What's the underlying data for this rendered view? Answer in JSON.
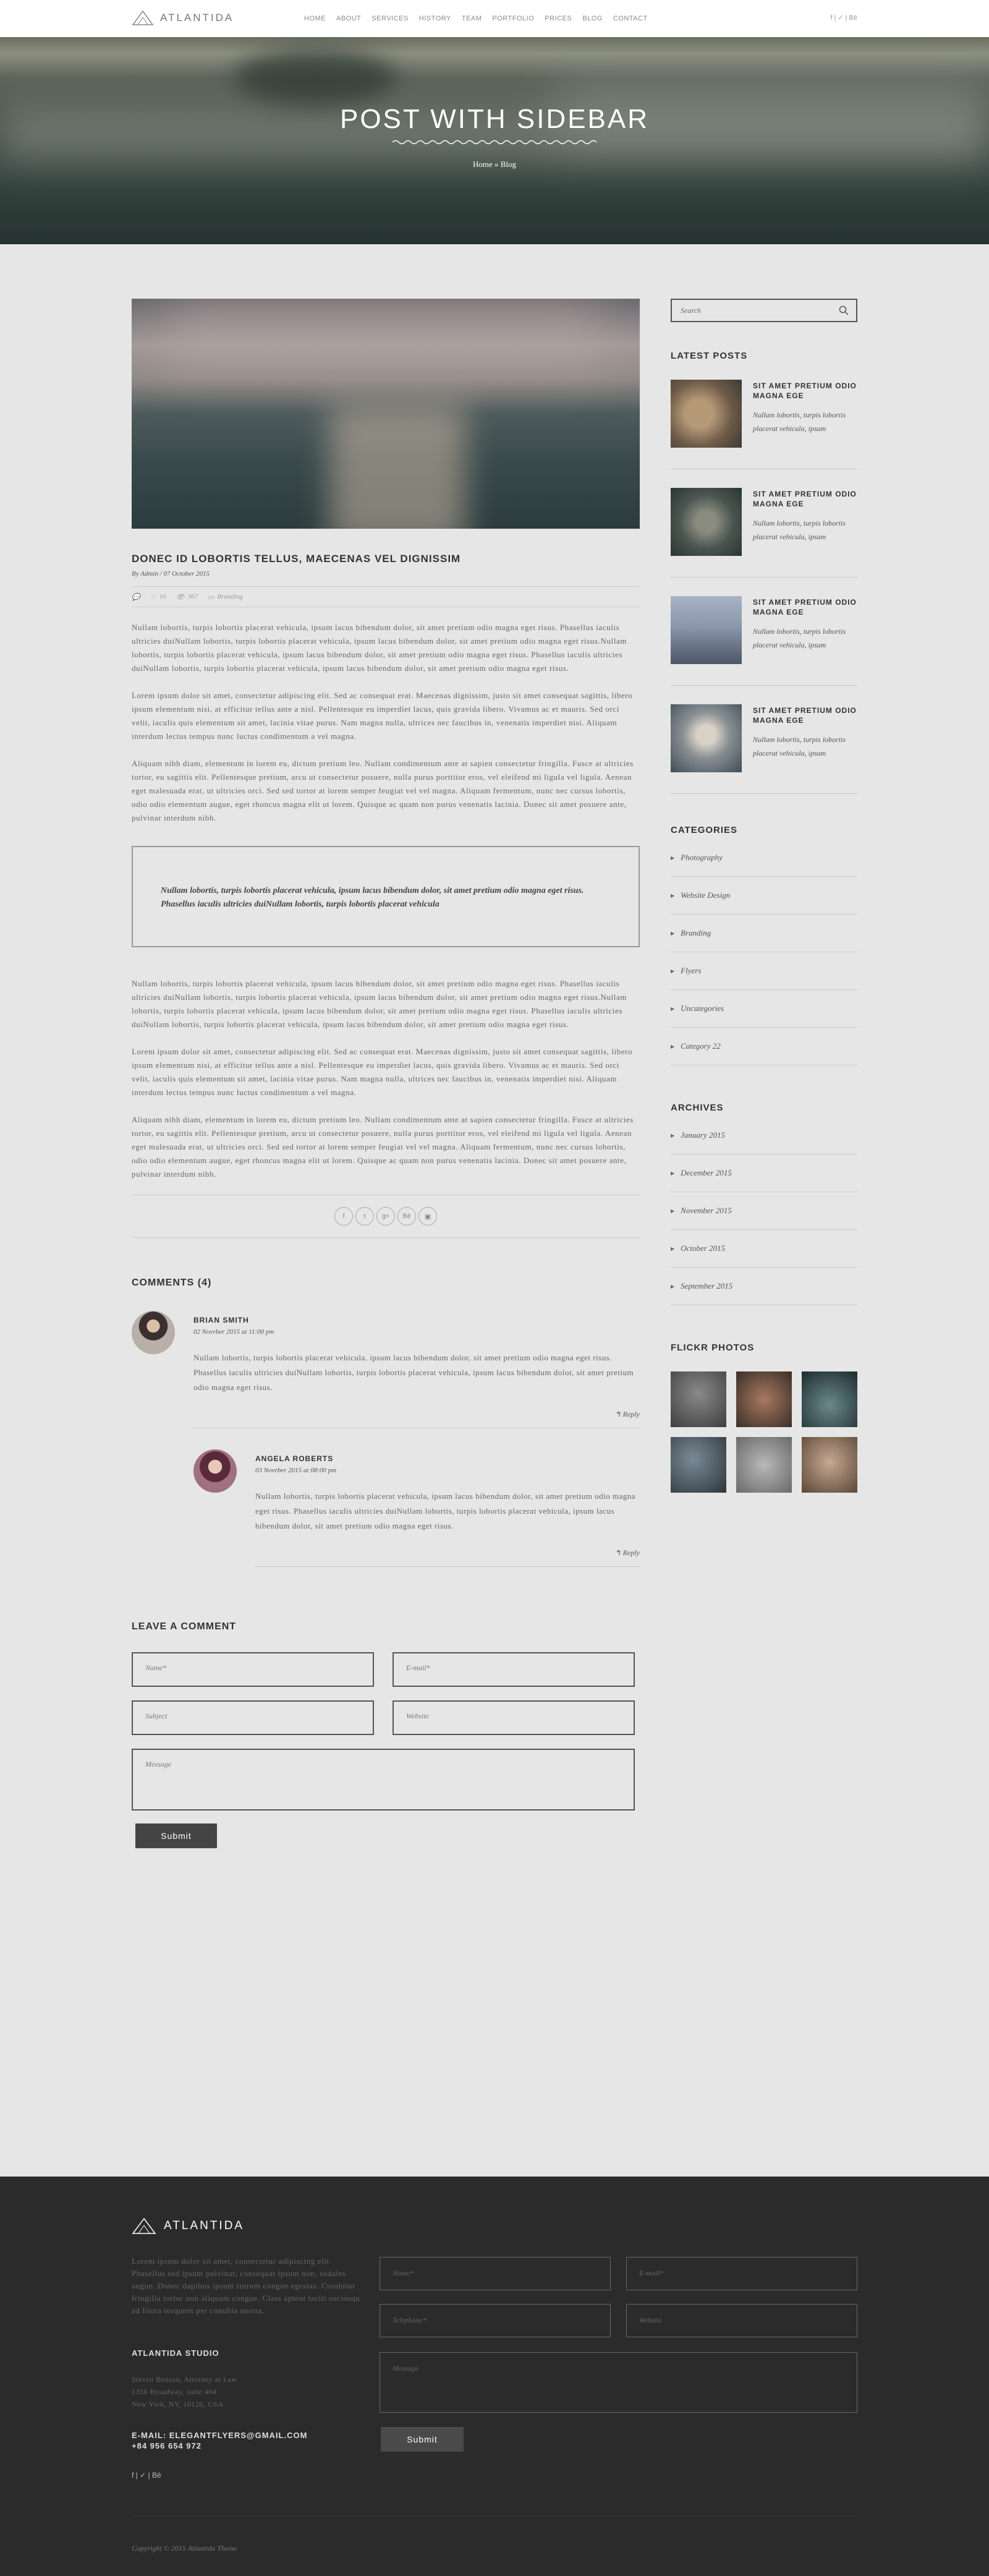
{
  "brand": {
    "name": "ATLANTIDA"
  },
  "nav": {
    "items": [
      "HOME",
      "ABOUT",
      "SERVICES",
      "HISTORY",
      "TEAM",
      "PORTFOLIO",
      "PRICES",
      "BLOG",
      "CONTACT"
    ],
    "social": "f | ✓ | Bē"
  },
  "hero": {
    "title": "POST WITH SIDEBAR",
    "breadcrumb": "Home » Blog"
  },
  "post": {
    "title": "DONEC ID LOBORTIS TELLUS, MAECENAS VEL DIGNISSIM",
    "meta": "By Admin / 07 October 2015",
    "stats": {
      "likes": "16",
      "views": "367",
      "category": "Branding"
    },
    "paragraphs": [
      "Nullam lobortis, turpis lobortis placerat vehicula, ipsum lacus bibendum dolor, sit amet pretium odio magna eget risus. Phasellus iaculis ultricies duiNullam lobortis, turpis lobortis placerat vehicula, ipsum lacus bibendum dolor, sit amet pretium odio magna eget risus.Nullam lobortis, turpis lobortis placerat vehicula, ipsum lacus bibendum dolor, sit amet pretium odio magna eget risus. Phasellus iaculis ultricies duiNullam lobortis, turpis lobortis placerat vehicula, ipsum lacus bibendum dolor, sit amet pretium odio magna eget risus.",
      "Lorem ipsum dolor sit amet, consectetur adipiscing elit. Sed ac consequat erat. Maecenas dignissim, justo sit amet consequat sagittis, libero ipsum elementum nisi, at efficitur tellus ante a nisl. Pellentesque eu imperdiet lacus, quis gravida libero. Vivamus ac et mauris. Sed orci velit, iaculis quis elementum sit amet, lacinia vitae purus. Nam magna nulla, ultrices nec faucibus in, venenatis imperdiet nisi. Aliquam interdum lectus tempus nunc luctus condimentum a vel magna.",
      "Aliquam nibh diam, elementum in lorem eu, dictum pretium leo. Nullam condimentum ante at sapien consectetur fringilla. Fusce at ultricies tortor, eu sagittis elit. Pellentesque pretium, arcu ut consectetur posuere, nulla purus porttitor eros, vel eleifend mi ligula vel ligula. Aenean eget malesuada erat, ut ultricies orci. Sed sed tortor at lorem semper feugiat vel vel magna. Aliquam fermentum, nunc nec cursus lobortis, odio odio elementum augue, eget rhoncus magna elit ut lorem. Quisque ac quam non purus venenatis lacinia. Donec sit amet posuere ante, pulvinar interdum nibh."
    ],
    "quote": "Nullam lobortis, turpis lobortis placerat vehicula, ipsum lacus bibendum dolor, sit amet pretium odio magna eget risus. Phasellus iaculis ultricies duiNullam lobortis, turpis lobortis placerat vehicula",
    "share": [
      "f",
      "t",
      "g+",
      "Bē",
      "▣"
    ]
  },
  "comments": {
    "heading": "COMMENTS (4)",
    "items": [
      {
        "name": "BRIAN SMITH",
        "date": "02 Novrber 2015 at 11:00 pm",
        "text": "Nullam lobortis, turpis lobortis placerat vehicula, ipsum lacus bibendum dolor, sit amet pretium odio magna eget risus. Phasellus iaculis ultricies duiNullam lobortis, turpis lobortis placerat vehicula, ipsum lacus bibendum dolor, sit amet pretium odio magna eget risus.",
        "reply": "Reply"
      },
      {
        "name": "ANGELA ROBERTS",
        "date": "03 Novrber 2015 at 08:00 pm",
        "text": "Nullam lobortis, turpis lobortis placerat vehicula, ipsum lacus bibendum dolor, sit amet pretium odio magna eget risus. Phasellus iaculis ultricies duiNullam lobortis, turpis lobortis placerat vehicula, ipsum lacus bibendum dolor, sit amet pretium odio magna eget risus.",
        "reply": "Reply"
      }
    ]
  },
  "leave": {
    "heading": "LEAVE A COMMENT",
    "name": "Name*",
    "email": "E-mail*",
    "subject": "Subject",
    "website": "Website",
    "message": "Message",
    "submit": "Submit"
  },
  "sidebar": {
    "search_placeholder": "Search",
    "latest_heading": "LATEST POSTS",
    "latest": [
      {
        "title": "SIT AMET PRETIUM ODIO MAGNA EGE",
        "text": "Nullam lobortis, turpis lobortis placerat vehicula, ipsum"
      },
      {
        "title": "SIT AMET PRETIUM ODIO MAGNA EGE",
        "text": "Nullam lobortis, turpis lobortis placerat vehicula, ipsum"
      },
      {
        "title": "SIT AMET PRETIUM ODIO MAGNA EGE",
        "text": "Nullam lobortis, turpis lobortis placerat vehicula, ipsum"
      },
      {
        "title": "SIT AMET PRETIUM ODIO MAGNA EGE",
        "text": "Nullam lobortis, turpis lobortis placerat vehicula, ipsum"
      }
    ],
    "categories_heading": "CATEGORIES",
    "categories": [
      "Photography",
      "Website Design",
      "Branding",
      "Flyers",
      "Uncategories",
      "Category 22"
    ],
    "archives_heading": "ARCHIVES",
    "archives": [
      "January 2015",
      "December 2015",
      "November 2015",
      "October 2015",
      "September 2015"
    ],
    "flickr_heading": "FLICKR PHOTOS"
  },
  "footer": {
    "brand": "ATLANTIDA",
    "about": "Lorem ipsum dolor sit amet, consectetur adipiscing elit. Phasellus sed ipsum pulvinar, consequat ipsum non, sodales augue. Donec dapibus ipsum rutrum congue egestas. Curabitur fringilla tortor non aliquam congue. Class aptent taciti sociosqu ad litora torquent per conubia nostra.",
    "studio": "ATLANTIDA STUDIO",
    "address": [
      "Steven Benson, Attorney at Law",
      "1356 Broadway, suite 404",
      "New York, NY, 10120, USA"
    ],
    "email": "E-MAIL: ELEGANTFLYERS@GMAIL.COM",
    "phone": "+84 956 654 972",
    "social": "f | ✓ | Bē",
    "form": {
      "name": "Name*",
      "email": "E-mail*",
      "telephone": "Telephone*",
      "website": "Website",
      "message": "Message",
      "submit": "Submit"
    },
    "copyright": "Copyright © 2015 Atlantida Theme"
  }
}
